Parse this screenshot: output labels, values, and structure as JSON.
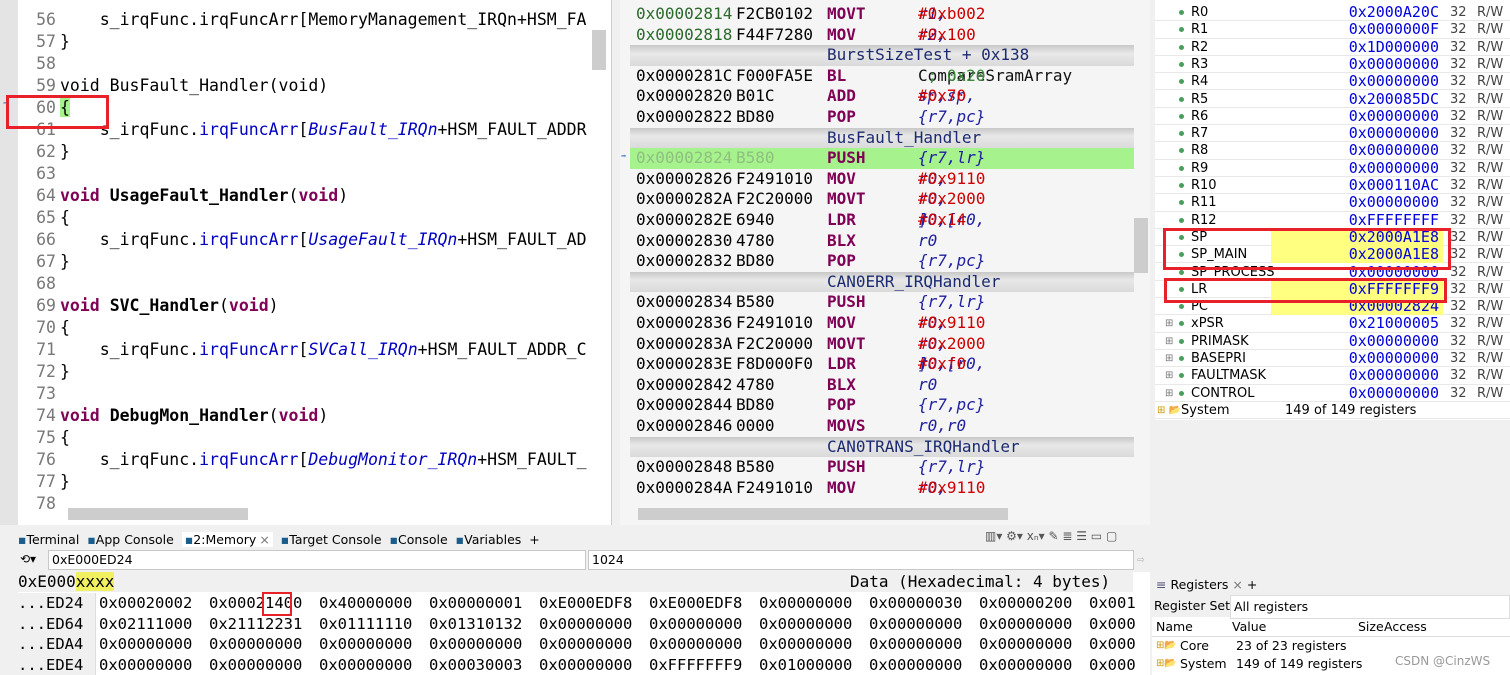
{
  "editor": {
    "lines": [
      {
        "n": "56",
        "segs": [
          [
            "    s_irqFunc.irqFuncArr[MemoryManagement_IRQn+HSM_FA",
            ""
          ]
        ]
      },
      {
        "n": "57",
        "segs": [
          [
            "}",
            ""
          ]
        ]
      },
      {
        "n": "58",
        "segs": []
      },
      {
        "n": "59",
        "segs": [
          [
            "void BusFault_Handler(void)",
            ""
          ]
        ]
      },
      {
        "n": "60",
        "segs": [
          [
            "{",
            "hl"
          ]
        ],
        "current": true
      },
      {
        "n": "61",
        "segs": [
          [
            "    s_irqFunc.",
            ""
          ],
          [
            "irqFuncArr",
            "mem"
          ],
          [
            "[",
            ""
          ],
          [
            "BusFault_IRQn",
            "en"
          ],
          [
            "+HSM_FAULT_ADDR",
            ""
          ]
        ]
      },
      {
        "n": "62",
        "segs": [
          [
            "}",
            ""
          ]
        ]
      },
      {
        "n": "63",
        "segs": []
      },
      {
        "n": "64",
        "segs": [
          [
            "void",
            "kw"
          ],
          [
            " ",
            ""
          ],
          [
            "UsageFault_Handler",
            "fn"
          ],
          [
            "(",
            ""
          ],
          [
            "void",
            "kw"
          ],
          [
            ")",
            ""
          ]
        ]
      },
      {
        "n": "65",
        "segs": [
          [
            "{",
            ""
          ]
        ]
      },
      {
        "n": "66",
        "segs": [
          [
            "    s_irqFunc.",
            ""
          ],
          [
            "irqFuncArr",
            "mem"
          ],
          [
            "[",
            ""
          ],
          [
            "UsageFault_IRQn",
            "en"
          ],
          [
            "+HSM_FAULT_AD",
            ""
          ]
        ]
      },
      {
        "n": "67",
        "segs": [
          [
            "}",
            ""
          ]
        ]
      },
      {
        "n": "68",
        "segs": []
      },
      {
        "n": "69",
        "segs": [
          [
            "void",
            "kw"
          ],
          [
            " ",
            ""
          ],
          [
            "SVC_Handler",
            "fn"
          ],
          [
            "(",
            ""
          ],
          [
            "void",
            "kw"
          ],
          [
            ")",
            ""
          ]
        ]
      },
      {
        "n": "70",
        "segs": [
          [
            "{",
            ""
          ]
        ]
      },
      {
        "n": "71",
        "segs": [
          [
            "    s_irqFunc.",
            ""
          ],
          [
            "irqFuncArr",
            "mem"
          ],
          [
            "[",
            ""
          ],
          [
            "SVCall_IRQn",
            "en"
          ],
          [
            "+HSM_FAULT_ADDR_C",
            ""
          ]
        ]
      },
      {
        "n": "72",
        "segs": [
          [
            "}",
            ""
          ]
        ]
      },
      {
        "n": "73",
        "segs": []
      },
      {
        "n": "74",
        "segs": [
          [
            "void",
            "kw"
          ],
          [
            " ",
            ""
          ],
          [
            "DebugMon_Handler",
            "fn"
          ],
          [
            "(",
            ""
          ],
          [
            "void",
            "kw"
          ],
          [
            ")",
            ""
          ]
        ]
      },
      {
        "n": "75",
        "segs": [
          [
            "{",
            ""
          ]
        ]
      },
      {
        "n": "76",
        "segs": [
          [
            "    s_irqFunc.",
            ""
          ],
          [
            "irqFuncArr",
            "mem"
          ],
          [
            "[",
            ""
          ],
          [
            "DebugMonitor_IRQn",
            "en"
          ],
          [
            "+HSM_FAULT_",
            ""
          ]
        ]
      },
      {
        "n": "77",
        "segs": [
          [
            "}",
            ""
          ]
        ]
      },
      {
        "n": "78",
        "segs": []
      }
    ]
  },
  "disassembly": {
    "rows": [
      {
        "addr": "0x00002814",
        "hex": "F2CB0102",
        "mn": "MOVT",
        "op": "r1,",
        "imm": "#0xb002",
        "green": true
      },
      {
        "addr": "0x00002818",
        "hex": "F44F7280",
        "mn": "MOV",
        "op": "r2,",
        "imm": "#0x100",
        "green": true
      },
      {
        "sym": "BurstSizeTest + 0x138"
      },
      {
        "addr": "0x0000281C",
        "hex": "F000FA5E",
        "mn": "BL",
        "op": "CompareSramArray",
        "cmt": " ; 0x20",
        "plain": true
      },
      {
        "addr": "0x00002820",
        "hex": "B01C",
        "mn": "ADD",
        "op": "sp,sp,",
        "imm": "#0x70"
      },
      {
        "addr": "0x00002822",
        "hex": "BD80",
        "mn": "POP",
        "op": "{r7,pc}"
      },
      {
        "sym": "BusFault_Handler"
      },
      {
        "addr": "0x00002824",
        "hex": "B580",
        "mn": "PUSH",
        "op": "{r7,lr}",
        "current": true
      },
      {
        "addr": "0x00002826",
        "hex": "F2491010",
        "mn": "MOV",
        "op": "r0,",
        "imm": "#0x9110"
      },
      {
        "addr": "0x0000282A",
        "hex": "F2C20000",
        "mn": "MOVT",
        "op": "r0,",
        "imm": "#0x2000"
      },
      {
        "addr": "0x0000282E",
        "hex": "6940",
        "mn": "LDR",
        "op": "r0,[r0,",
        "imm": "#0x14",
        "tail": "]"
      },
      {
        "addr": "0x00002830",
        "hex": "4780",
        "mn": "BLX",
        "op": "r0"
      },
      {
        "addr": "0x00002832",
        "hex": "BD80",
        "mn": "POP",
        "op": "{r7,pc}"
      },
      {
        "sym": "CAN0ERR_IRQHandler"
      },
      {
        "addr": "0x00002834",
        "hex": "B580",
        "mn": "PUSH",
        "op": "{r7,lr}"
      },
      {
        "addr": "0x00002836",
        "hex": "F2491010",
        "mn": "MOV",
        "op": "r0,",
        "imm": "#0x9110"
      },
      {
        "addr": "0x0000283A",
        "hex": "F2C20000",
        "mn": "MOVT",
        "op": "r0,",
        "imm": "#0x2000"
      },
      {
        "addr": "0x0000283E",
        "hex": "F8D000F0",
        "mn": "LDR",
        "op": "r0,[r0,",
        "imm": "#0xf0",
        "tail": "]"
      },
      {
        "addr": "0x00002842",
        "hex": "4780",
        "mn": "BLX",
        "op": "r0"
      },
      {
        "addr": "0x00002844",
        "hex": "BD80",
        "mn": "POP",
        "op": "{r7,pc}"
      },
      {
        "addr": "0x00002846",
        "hex": "0000",
        "mn": "MOVS",
        "op": "r0,r0"
      },
      {
        "sym": "CAN0TRANS_IRQHandler"
      },
      {
        "addr": "0x00002848",
        "hex": "B580",
        "mn": "PUSH",
        "op": "{r7,lr}"
      },
      {
        "addr": "0x0000284A",
        "hex": "F2491010",
        "mn": "MOV",
        "op": "r0,",
        "imm": "#0x9110"
      }
    ]
  },
  "registers": {
    "rows": [
      {
        "name": "R0",
        "value": "0x2000A20C",
        "size": "32",
        "access": "R/W"
      },
      {
        "name": "R1",
        "value": "0x0000000F",
        "size": "32",
        "access": "R/W"
      },
      {
        "name": "R2",
        "value": "0x1D000000",
        "size": "32",
        "access": "R/W"
      },
      {
        "name": "R3",
        "value": "0x00000000",
        "size": "32",
        "access": "R/W"
      },
      {
        "name": "R4",
        "value": "0x00000000",
        "size": "32",
        "access": "R/W"
      },
      {
        "name": "R5",
        "value": "0x200085DC",
        "size": "32",
        "access": "R/W"
      },
      {
        "name": "R6",
        "value": "0x00000000",
        "size": "32",
        "access": "R/W"
      },
      {
        "name": "R7",
        "value": "0x00000000",
        "size": "32",
        "access": "R/W"
      },
      {
        "name": "R8",
        "value": "0x00000000",
        "size": "32",
        "access": "R/W"
      },
      {
        "name": "R9",
        "value": "0x00000000",
        "size": "32",
        "access": "R/W"
      },
      {
        "name": "R10",
        "value": "0x000110AC",
        "size": "32",
        "access": "R/W"
      },
      {
        "name": "R11",
        "value": "0x00000000",
        "size": "32",
        "access": "R/W"
      },
      {
        "name": "R12",
        "value": "0xFFFFFFFF",
        "size": "32",
        "access": "R/W"
      },
      {
        "name": "SP",
        "value": "0x2000A1E8",
        "size": "32",
        "access": "R/W",
        "changed": true
      },
      {
        "name": "SP_MAIN",
        "value": "0x2000A1E8",
        "size": "32",
        "access": "R/W",
        "changed": true
      },
      {
        "name": "SP_PROCESS",
        "value": "0x00000000",
        "size": "32",
        "access": "R/W"
      },
      {
        "name": "LR",
        "value": "0xFFFFFFF9",
        "size": "32",
        "access": "R/W",
        "changed": true
      },
      {
        "name": "PC",
        "value": "0x00002824",
        "size": "32",
        "access": "R/W",
        "changed": true
      },
      {
        "name": "xPSR",
        "value": "0x21000005",
        "size": "32",
        "access": "R/W",
        "group": true
      },
      {
        "name": "PRIMASK",
        "value": "0x00000000",
        "size": "32",
        "access": "R/W",
        "group": true
      },
      {
        "name": "BASEPRI",
        "value": "0x00000000",
        "size": "32",
        "access": "R/W",
        "group": true
      },
      {
        "name": "FAULTMASK",
        "value": "0x00000000",
        "size": "32",
        "access": "R/W",
        "group": true
      },
      {
        "name": "CONTROL",
        "value": "0x00000000",
        "size": "32",
        "access": "R/W",
        "group": true
      }
    ],
    "system": {
      "name": "System",
      "value": "149 of 149 registers"
    }
  },
  "tabs": [
    {
      "label": "Terminal",
      "icon": "terminal-icon"
    },
    {
      "label": "App Console",
      "icon": "console-icon"
    },
    {
      "label": "2:Memory",
      "icon": "memory-icon",
      "active": true
    },
    {
      "label": "Target Console",
      "icon": "console-icon"
    },
    {
      "label": "Console",
      "icon": "console-icon"
    },
    {
      "label": "Variables",
      "icon": "variables-icon"
    }
  ],
  "tab_add": "+",
  "tab_close": "×",
  "memory": {
    "address": "0xE000ED24",
    "length": "1024",
    "base_prefix": "0xE000",
    "base_suffix": "xxxx",
    "header": "Data (Hexadecimal: 4 bytes)",
    "rows": [
      {
        "addr": "...ED24",
        "cells": [
          "0x00020002",
          "0x00021400",
          "0x40000000",
          "0x00000001",
          "0xE000EDF8",
          "0xE000EDF8",
          "0x00000000",
          "0x00000030",
          "0x00000200",
          "0x001"
        ]
      },
      {
        "addr": "...ED64",
        "cells": [
          "0x02111000",
          "0x21112231",
          "0x01111110",
          "0x01310132",
          "0x00000000",
          "0x00000000",
          "0x00000000",
          "0x00000000",
          "0x00000000",
          "0x000"
        ]
      },
      {
        "addr": "...EDA4",
        "cells": [
          "0x00000000",
          "0x00000000",
          "0x00000000",
          "0x00000000",
          "0x00000000",
          "0x00000000",
          "0x00000000",
          "0x00000000",
          "0x00000000",
          "0x000"
        ]
      },
      {
        "addr": "...EDE4",
        "cells": [
          "0x00000000",
          "0x00000000",
          "0x00000000",
          "0x00030003",
          "0x00000000",
          "0xFFFFFFF9",
          "0x01000000",
          "0x00000000",
          "0x00000000",
          "0x000"
        ]
      }
    ]
  },
  "reg_panel": {
    "tab": "Registers",
    "set_label": "Register Set:",
    "set_value": "All registers",
    "cols": [
      "Name",
      "Value",
      "Size",
      "Access"
    ],
    "rows": [
      {
        "name": "Core",
        "value": "23 of 23 registers"
      },
      {
        "name": "System",
        "value": "149 of 149 registers"
      }
    ]
  },
  "watermark": "CSDN @CinzWS",
  "colors": {
    "highlight_red": "#e8202a",
    "current_line": "#a6f28c",
    "changed_value": "#ffff80"
  }
}
